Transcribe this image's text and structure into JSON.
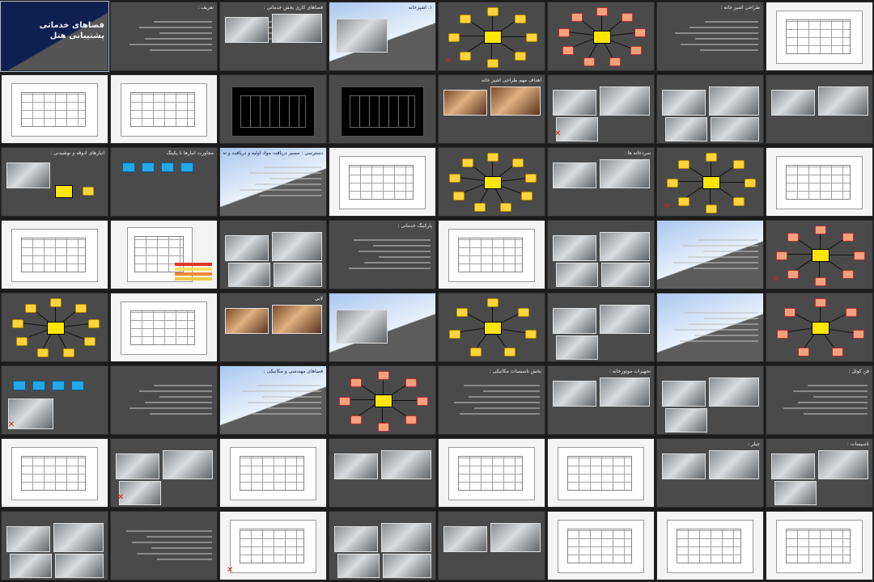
{
  "view": "slide-sorter",
  "slides": [
    {
      "n": 1,
      "type": "navy",
      "title": "فضاهای خدماتی پشتیبانی هتل"
    },
    {
      "n": 2,
      "type": "text",
      "title": "تعریف :"
    },
    {
      "n": 3,
      "type": "text-photos",
      "title": "فضاهای کاری بخش خدماتی :"
    },
    {
      "n": 4,
      "type": "blue-photo",
      "title": "۱. آشپزخانه"
    },
    {
      "n": 5,
      "type": "mindmap",
      "title": ""
    },
    {
      "n": 6,
      "type": "mindmap",
      "title": ""
    },
    {
      "n": 7,
      "type": "text",
      "title": "طراحی آشپز خانه :"
    },
    {
      "n": 8,
      "type": "plan",
      "title": ""
    },
    {
      "n": 9,
      "type": "plan",
      "title": ""
    },
    {
      "n": 10,
      "type": "plan",
      "title": ""
    },
    {
      "n": 11,
      "type": "cad",
      "title": ""
    },
    {
      "n": 12,
      "type": "cad",
      "title": ""
    },
    {
      "n": 13,
      "type": "photo-warm",
      "title": "اهداف مهم طراحی آشپز خانه"
    },
    {
      "n": 14,
      "type": "photos",
      "title": ""
    },
    {
      "n": 15,
      "type": "photos",
      "title": ""
    },
    {
      "n": 16,
      "type": "photos",
      "title": ""
    },
    {
      "n": 17,
      "type": "diagram",
      "title": "انبارهای آذوقه و نوشیدنی :"
    },
    {
      "n": 18,
      "type": "cubes",
      "title": "مجاورت انبارها با پکینگ"
    },
    {
      "n": 19,
      "type": "blue-text",
      "title": "دسترسی : مسیر دریافت مواد اولیه و دریافت و تحویل"
    },
    {
      "n": 20,
      "type": "plan",
      "title": ""
    },
    {
      "n": 21,
      "type": "mindmap",
      "title": ""
    },
    {
      "n": 22,
      "type": "photos",
      "title": "سردخانه ها :"
    },
    {
      "n": 23,
      "type": "mindmap",
      "title": ""
    },
    {
      "n": 24,
      "type": "plan",
      "title": ""
    },
    {
      "n": 25,
      "type": "plan",
      "title": ""
    },
    {
      "n": 26,
      "type": "section",
      "title": ""
    },
    {
      "n": 27,
      "type": "photos",
      "title": ""
    },
    {
      "n": 28,
      "type": "text",
      "title": "پارکینگ خدماتی :"
    },
    {
      "n": 29,
      "type": "plan",
      "title": ""
    },
    {
      "n": 30,
      "type": "photos",
      "title": ""
    },
    {
      "n": 31,
      "type": "blue-text",
      "title": ""
    },
    {
      "n": 32,
      "type": "mindmap",
      "title": ""
    },
    {
      "n": 33,
      "type": "mindmap",
      "title": ""
    },
    {
      "n": 34,
      "type": "plan",
      "title": ""
    },
    {
      "n": 35,
      "type": "photo-warm",
      "title": "لابی"
    },
    {
      "n": 36,
      "type": "blue-photo",
      "title": ""
    },
    {
      "n": 37,
      "type": "mindmap",
      "title": ""
    },
    {
      "n": 38,
      "type": "photos",
      "title": ""
    },
    {
      "n": 39,
      "type": "blue-text",
      "title": ""
    },
    {
      "n": 40,
      "type": "mindmap",
      "title": ""
    },
    {
      "n": 41,
      "type": "cubes",
      "title": ""
    },
    {
      "n": 42,
      "type": "text",
      "title": ""
    },
    {
      "n": 43,
      "type": "blue-text",
      "title": "فضاهای مهندسی و مکانیکی :"
    },
    {
      "n": 44,
      "type": "mindmap",
      "title": ""
    },
    {
      "n": 45,
      "type": "text",
      "title": "بخش تاسیسات مکانیکی :"
    },
    {
      "n": 46,
      "type": "photos",
      "title": "تجهیزات موتورخانه :"
    },
    {
      "n": 47,
      "type": "photos",
      "title": ""
    },
    {
      "n": 48,
      "type": "text",
      "title": "فن کوئل :"
    },
    {
      "n": 49,
      "type": "plan",
      "title": ""
    },
    {
      "n": 50,
      "type": "photos",
      "title": ""
    },
    {
      "n": 51,
      "type": "plan",
      "title": ""
    },
    {
      "n": 52,
      "type": "photos",
      "title": ""
    },
    {
      "n": 53,
      "type": "plan",
      "title": ""
    },
    {
      "n": 54,
      "type": "plan",
      "title": ""
    },
    {
      "n": 55,
      "type": "photos",
      "title": "چیلر :"
    },
    {
      "n": 56,
      "type": "photos",
      "title": "تاسیسات :"
    },
    {
      "n": 57,
      "type": "photos",
      "title": ""
    },
    {
      "n": 58,
      "type": "text",
      "title": ""
    },
    {
      "n": 59,
      "type": "plan",
      "title": ""
    },
    {
      "n": 60,
      "type": "photos",
      "title": ""
    },
    {
      "n": 61,
      "type": "photos",
      "title": ""
    },
    {
      "n": 62,
      "type": "plan",
      "title": ""
    },
    {
      "n": 63,
      "type": "plan",
      "title": ""
    },
    {
      "n": 64,
      "type": "plan",
      "title": ""
    }
  ],
  "selected_slide": 1
}
